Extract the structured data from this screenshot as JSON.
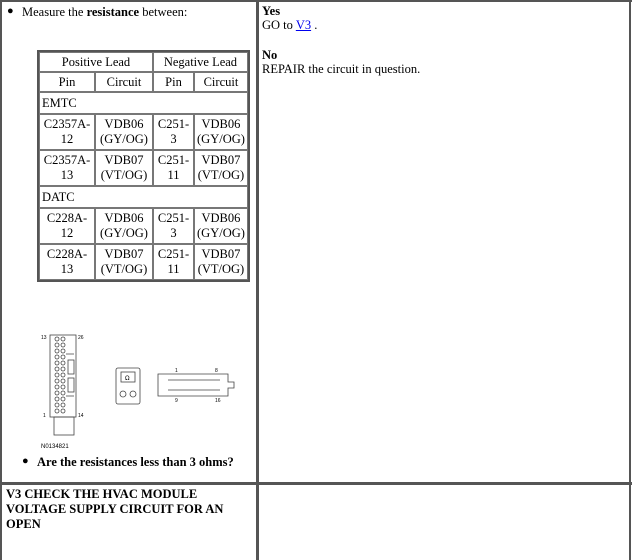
{
  "step_instruction": {
    "prefix": "Measure the ",
    "bold": "resistance",
    "suffix": " between:"
  },
  "measure_table": {
    "header_groups": [
      "Positive Lead",
      "Negative Lead"
    ],
    "subheaders": [
      "Pin",
      "Circuit",
      "Pin",
      "Circuit"
    ],
    "groups": [
      {
        "label": "EMTC",
        "rows": [
          {
            "pos_pin": "C2357A-12",
            "pos_circuit": "VDB06 (GY/OG)",
            "neg_pin": "C251-3",
            "neg_circuit": "VDB06 (GY/OG)"
          },
          {
            "pos_pin": "C2357A-13",
            "pos_circuit": "VDB07 (VT/OG)",
            "neg_pin": "C251-11",
            "neg_circuit": "VDB07 (VT/OG)"
          }
        ]
      },
      {
        "label": "DATC",
        "rows": [
          {
            "pos_pin": "C228A-12",
            "pos_circuit": "VDB06 (GY/OG)",
            "neg_pin": "C251-3",
            "neg_circuit": "VDB06 (GY/OG)"
          },
          {
            "pos_pin": "C228A-13",
            "pos_circuit": "VDB07 (VT/OG)",
            "neg_pin": "C251-11",
            "neg_circuit": "VDB07 (VT/OG)"
          }
        ]
      }
    ]
  },
  "diagram": {
    "figure_id": "N0134821",
    "connector_labels": {
      "top_left": "13",
      "top_right": "26",
      "bottom_left": "1",
      "bottom_right": "14"
    },
    "dlc_labels": {
      "top_left": "1",
      "top_right": "8",
      "bottom_left": "9",
      "bottom_right": "16"
    },
    "meter_symbol": "Ω"
  },
  "question": "Are the resistances less than 3 ohms?",
  "results": {
    "yes_label": "Yes",
    "yes_action_prefix": "GO to ",
    "yes_link": "V3",
    "yes_action_suffix": " .",
    "no_label": "No",
    "no_action": "REPAIR the circuit in question."
  },
  "next_step": {
    "title": "V3 CHECK THE HVAC MODULE VOLTAGE SUPPLY CIRCUIT FOR AN OPEN"
  }
}
